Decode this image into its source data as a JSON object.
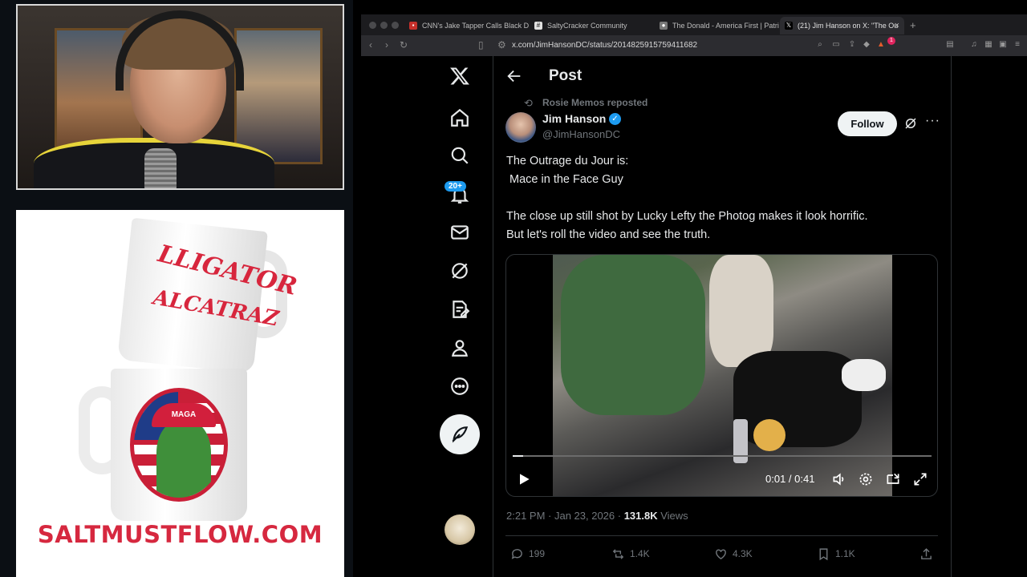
{
  "overlay": {
    "merch_url": "SALTMUSTFLOW.COM",
    "mug_top_line1": "LLIGATOR",
    "mug_top_line2": "ALCATRAZ",
    "mug_badge": "MAGA"
  },
  "browser": {
    "tabs": [
      {
        "label": "CNN's Jake Tapper Calls Black DC",
        "active": false
      },
      {
        "label": "SaltyCracker Community",
        "active": false
      },
      {
        "label": "The Donald - America First | Patri",
        "active": false
      },
      {
        "label": "(21) Jim Hanson on X: \"The Ou",
        "active": true
      }
    ],
    "url": "x.com/JimHansonDC/status/2014825915759411682",
    "extension_badge": "1"
  },
  "x": {
    "notifications_badge": "20+",
    "header_title": "Post",
    "repost_label": "Rosie Memos reposted",
    "author_name": "Jim Hanson",
    "author_handle": "@JimHansonDC",
    "follow_label": "Follow",
    "post_line1": "The Outrage du Jour is:",
    "post_line2": " Mace in the Face Guy",
    "post_line3": "The close up still shot by Lucky Lefty the Photog makes it look horrific.",
    "post_line4": "But let's roll the video and see the truth.",
    "video_time": "0:01 / 0:41",
    "video_progress": 0.024,
    "timestamp": "2:21 PM · Jan 23, 2026 · ",
    "views_count": "131.8K",
    "views_label": " Views",
    "stats": {
      "replies": "199",
      "reposts": "1.4K",
      "likes": "4.3K",
      "bookmarks": "1.1K"
    }
  }
}
